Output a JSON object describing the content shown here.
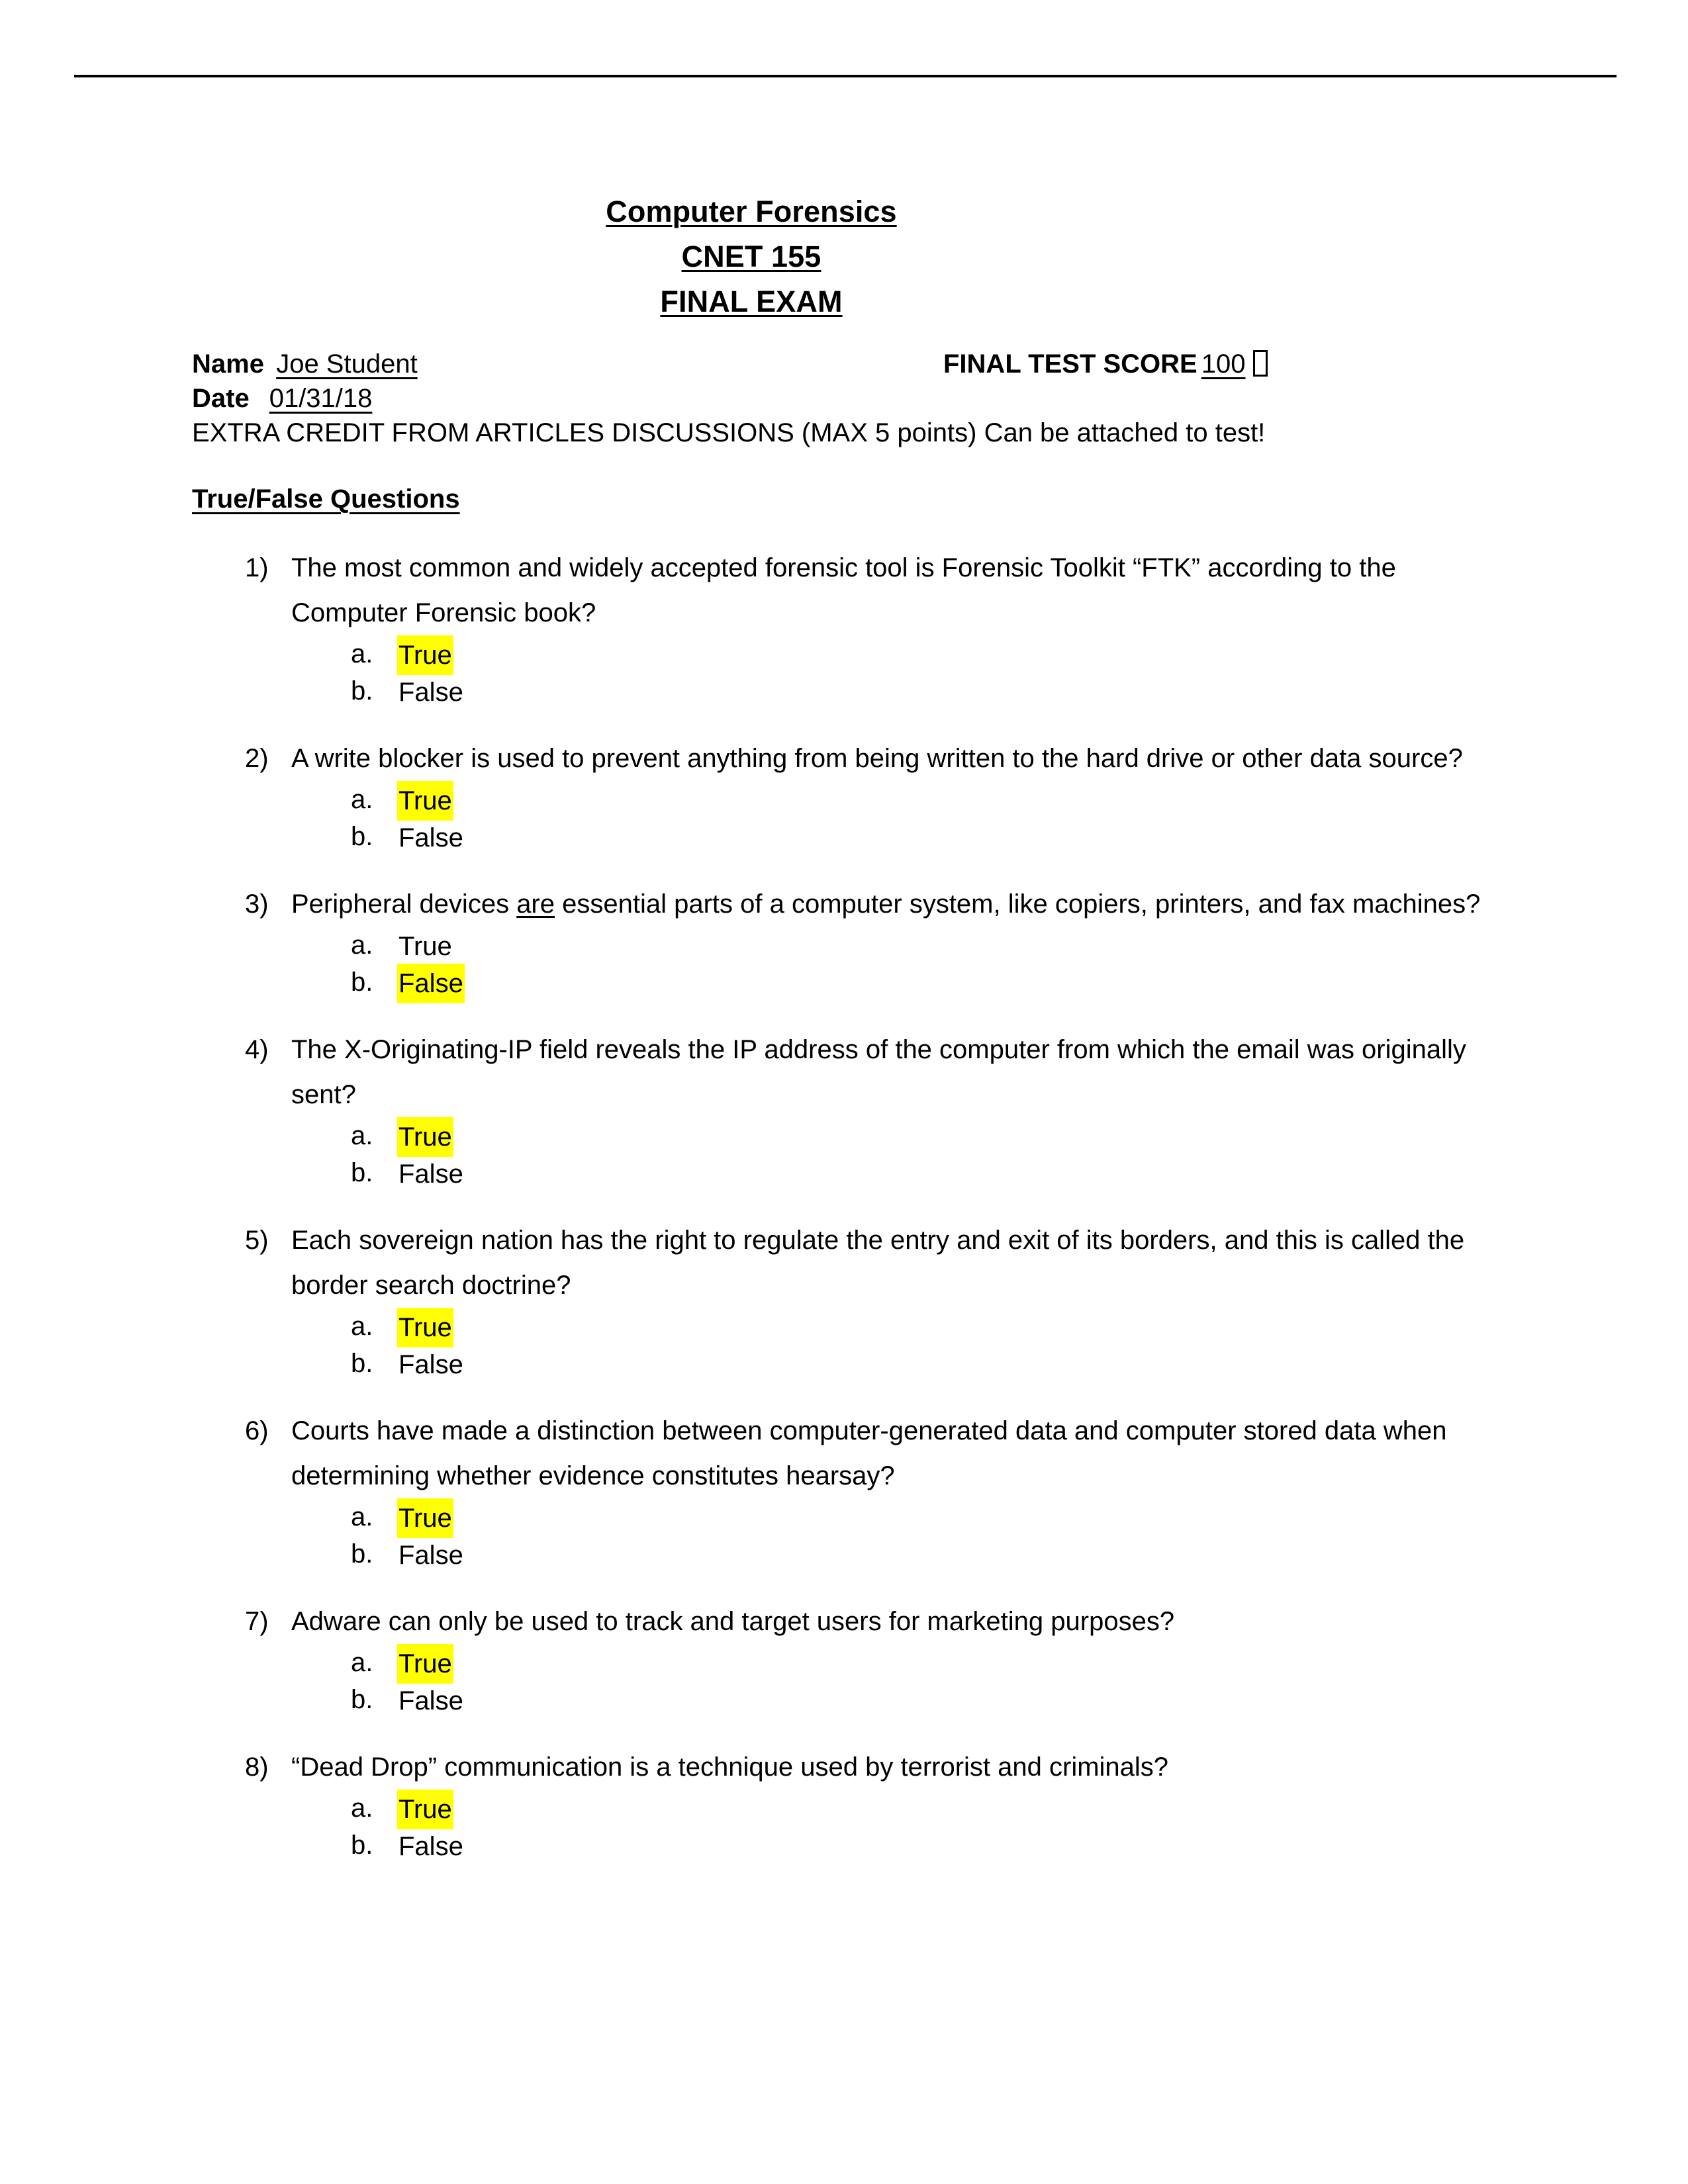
{
  "document": {
    "title_lines": [
      "Computer Forensics",
      "CNET 155",
      "FINAL EXAM"
    ],
    "name_label": "Name",
    "name_value": "Joe Student",
    "date_label": "Date",
    "date_value": "01/31/18",
    "score_label": "FINAL TEST SCORE",
    "score_value": "100",
    "score_trailing_glyph": "missing-glyph-box",
    "extra_credit": "EXTRA CREDIT FROM ARTICLES DISCUSSIONS (MAX 5 points) Can be attached to test!",
    "section_heading": "True/False Questions",
    "highlight_color": "#FFFF00",
    "text_color": "#000000",
    "page_background": "#FFFFFF"
  },
  "questions": [
    {
      "marker": "1)",
      "text_before": "The most common and widely accepted forensic tool is Forensic Toolkit “FTK” according to the Computer Forensic book?",
      "underlined": "",
      "text_after": "",
      "options": [
        {
          "marker": "a.",
          "label": "True",
          "highlighted": true
        },
        {
          "marker": "b.",
          "label": "False",
          "highlighted": false
        }
      ]
    },
    {
      "marker": "2)",
      "text_before": "A write blocker is used to prevent anything from being written to the hard drive or other data source?",
      "underlined": "",
      "text_after": "",
      "options": [
        {
          "marker": "a.",
          "label": "True",
          "highlighted": true
        },
        {
          "marker": "b.",
          "label": "False",
          "highlighted": false
        }
      ]
    },
    {
      "marker": "3)",
      "text_before": "Peripheral devices ",
      "underlined": "are",
      "text_after": " essential parts of a computer system, like copiers, printers, and fax machines?",
      "options": [
        {
          "marker": "a.",
          "label": "True",
          "highlighted": false
        },
        {
          "marker": "b.",
          "label": "False",
          "highlighted": true
        }
      ]
    },
    {
      "marker": "4)",
      "text_before": "The X-Originating-IP field reveals the IP address of the computer from which the email was originally sent?",
      "underlined": "",
      "text_after": "",
      "options": [
        {
          "marker": "a.",
          "label": "True",
          "highlighted": true
        },
        {
          "marker": "b.",
          "label": "False",
          "highlighted": false
        }
      ]
    },
    {
      "marker": "5)",
      "text_before": "Each sovereign nation has the right to regulate the entry and exit of its borders, and this is called the border search doctrine?",
      "underlined": "",
      "text_after": "",
      "options": [
        {
          "marker": "a.",
          "label": "True",
          "highlighted": true
        },
        {
          "marker": "b.",
          "label": "False",
          "highlighted": false
        }
      ]
    },
    {
      "marker": "6)",
      "text_before": "Courts have made a distinction between computer-generated data and computer stored data when determining whether evidence constitutes hearsay?",
      "underlined": "",
      "text_after": "",
      "options": [
        {
          "marker": "a.",
          "label": "True",
          "highlighted": true
        },
        {
          "marker": "b.",
          "label": "False",
          "highlighted": false
        }
      ]
    },
    {
      "marker": "7)",
      "text_before": "Adware can only be used to track and target users for marketing purposes?",
      "underlined": "",
      "text_after": "",
      "options": [
        {
          "marker": "a.",
          "label": "True",
          "highlighted": true
        },
        {
          "marker": "b.",
          "label": "False",
          "highlighted": false
        }
      ]
    },
    {
      "marker": "8)",
      "text_before": "“Dead Drop” communication is a technique used by terrorist and criminals?",
      "underlined": "",
      "text_after": "",
      "options": [
        {
          "marker": "a.",
          "label": "True",
          "highlighted": true
        },
        {
          "marker": "b.",
          "label": "False",
          "highlighted": false
        }
      ]
    }
  ]
}
